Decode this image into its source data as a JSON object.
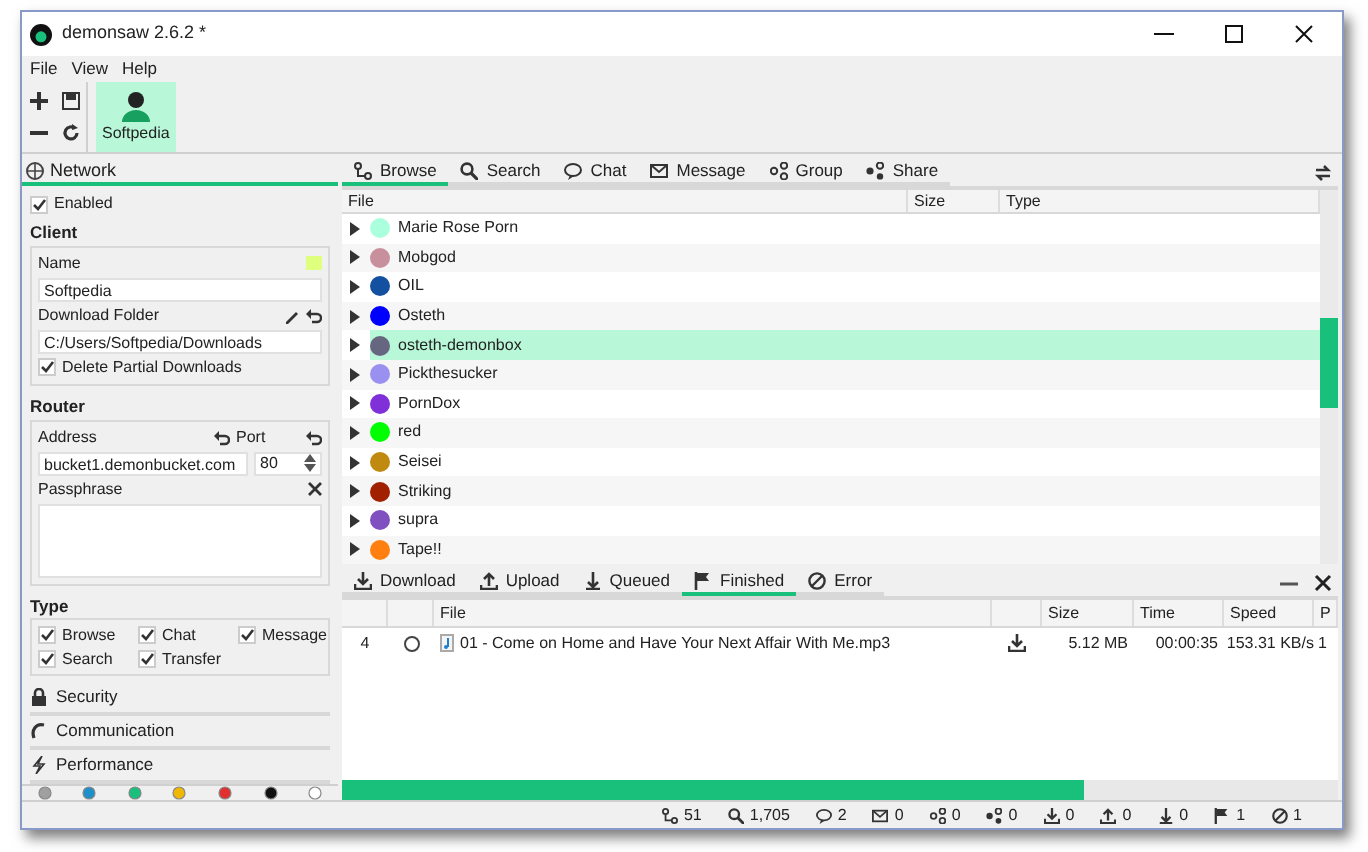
{
  "window": {
    "title": "demonsaw 2.6.2 *"
  },
  "menu": [
    "File",
    "View",
    "Help"
  ],
  "toolbar": {
    "users": [
      {
        "label": "Softpedia",
        "selected": true
      }
    ]
  },
  "network": {
    "title": "Network",
    "enabled": {
      "label": "Enabled",
      "checked": true
    },
    "client": {
      "title": "Client",
      "name_label": "Name",
      "name": "Softpedia",
      "color": "#dfff7f",
      "folder_label": "Download Folder",
      "folder": "C:/Users/Softpedia/Downloads",
      "delete_partial": {
        "label": "Delete Partial Downloads",
        "checked": true
      }
    },
    "router": {
      "title": "Router",
      "address_label": "Address",
      "address": "bucket1.demonbucket.com",
      "port_label": "Port",
      "port": "80",
      "passphrase_label": "Passphrase"
    },
    "type": {
      "title": "Type",
      "options": [
        {
          "label": "Browse",
          "checked": true
        },
        {
          "label": "Chat",
          "checked": true
        },
        {
          "label": "Message",
          "checked": true
        },
        {
          "label": "Search",
          "checked": true
        },
        {
          "label": "Transfer",
          "checked": true
        }
      ]
    },
    "sections": [
      {
        "kind": "security",
        "label": "Security"
      },
      {
        "kind": "communication",
        "label": "Communication"
      },
      {
        "kind": "performance",
        "label": "Performance"
      }
    ],
    "colors": [
      {
        "color": "#a0a0a0"
      },
      {
        "color": "#1e8fc8"
      },
      {
        "color": "#18c07c"
      },
      {
        "color": "#f0b800"
      },
      {
        "color": "#e03030"
      },
      {
        "color": "#101010"
      },
      {
        "color": "#ffffff"
      }
    ]
  },
  "tabs": [
    {
      "kind": "browse",
      "label": "Browse",
      "selected": true
    },
    {
      "kind": "search",
      "label": "Search",
      "selected": false
    },
    {
      "kind": "chat",
      "label": "Chat",
      "selected": false
    },
    {
      "kind": "message",
      "label": "Message",
      "selected": false
    },
    {
      "kind": "group",
      "label": "Group",
      "selected": false
    },
    {
      "kind": "share",
      "label": "Share",
      "selected": false
    }
  ],
  "browse": {
    "columns": [
      "File",
      "Size",
      "Type"
    ],
    "rows": [
      {
        "name": "Marie Rose Porn",
        "color": "#aaffdd",
        "selected": false
      },
      {
        "name": "Mobgod",
        "color": "#c8909c",
        "selected": false
      },
      {
        "name": "OIL",
        "color": "#1450a0",
        "selected": false
      },
      {
        "name": "Osteth",
        "color": "#0000ff",
        "selected": false
      },
      {
        "name": "osteth-demonbox",
        "color": "#666680",
        "selected": true
      },
      {
        "name": "Pickthesucker",
        "color": "#9a90f0",
        "selected": false
      },
      {
        "name": "PornDox",
        "color": "#8030d8",
        "selected": false
      },
      {
        "name": "red",
        "color": "#00ff00",
        "selected": false
      },
      {
        "name": "Seisei",
        "color": "#c08a10",
        "selected": false
      },
      {
        "name": "Striking",
        "color": "#a02000",
        "selected": false
      },
      {
        "name": "supra",
        "color": "#8050c0",
        "selected": false
      },
      {
        "name": "Tape!!",
        "color": "#ff8010",
        "selected": false
      }
    ]
  },
  "transfer_tabs": [
    {
      "kind": "download",
      "label": "Download",
      "selected": false
    },
    {
      "kind": "upload",
      "label": "Upload",
      "selected": false
    },
    {
      "kind": "queued",
      "label": "Queued",
      "selected": false
    },
    {
      "kind": "finished",
      "label": "Finished",
      "selected": true
    },
    {
      "kind": "error",
      "label": "Error",
      "selected": false
    }
  ],
  "transfers": {
    "columns": [
      "File",
      "Size",
      "Time",
      "Speed",
      "P"
    ],
    "rows": [
      {
        "index": "4",
        "file": "01 - Come on Home and Have Your Next Affair With Me.mp3",
        "size": "5.12 MB",
        "time": "00:00:35",
        "speed": "153.31 KB/s",
        "column_5": "1"
      }
    ],
    "level": 0.745
  },
  "status_bar": [
    {
      "kind": "browse",
      "count": "51"
    },
    {
      "kind": "search",
      "count": "1,705"
    },
    {
      "kind": "chat",
      "count": "2"
    },
    {
      "kind": "message",
      "count": "0"
    },
    {
      "kind": "group",
      "count": "0"
    },
    {
      "kind": "share",
      "count": "0"
    },
    {
      "kind": "download",
      "count": "0"
    },
    {
      "kind": "upload",
      "count": "0"
    },
    {
      "kind": "queued",
      "count": "0"
    },
    {
      "kind": "finished",
      "count": "1"
    },
    {
      "kind": "error",
      "count": "1"
    }
  ]
}
